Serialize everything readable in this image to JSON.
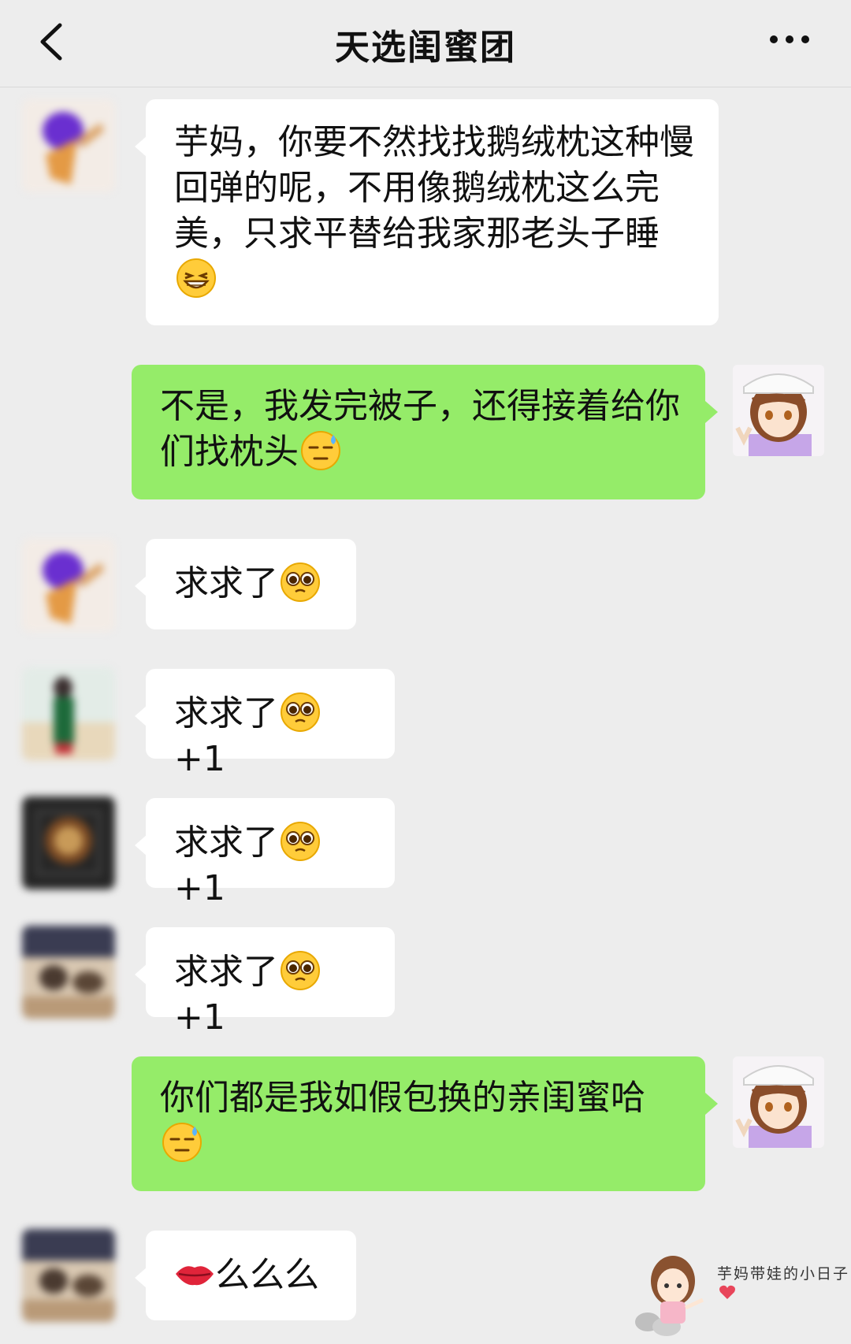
{
  "header": {
    "title": "天选闺蜜团"
  },
  "messages": [
    {
      "side": "in",
      "text": "芋妈，你要不然找找鹅绒枕这种慢回弹的呢，不用像鹅绒枕这么完美，只求平替给我家那老头子睡",
      "emoji": "grinning-squint-emoji"
    },
    {
      "side": "out",
      "text": "不是，我发完被子，还得接着给你们找枕头",
      "emoji": "downcast-sweat-emoji"
    },
    {
      "side": "in",
      "text": "求求了",
      "emoji": "pleading-emoji",
      "suffix": ""
    },
    {
      "side": "in",
      "text": "求求了",
      "emoji": "pleading-emoji",
      "suffix": "+1"
    },
    {
      "side": "in",
      "text": "求求了",
      "emoji": "pleading-emoji",
      "suffix": "+1"
    },
    {
      "side": "in",
      "text": "求求了",
      "emoji": "pleading-emoji",
      "suffix": "+1"
    },
    {
      "side": "out",
      "text": "你们都是我如假包换的亲闺蜜哈",
      "emoji": "downcast-sweat-emoji"
    },
    {
      "side": "in",
      "prefix_emoji": "lips-emoji",
      "text": "么么么"
    }
  ],
  "watermark": {
    "text": "芋妈带娃的小日子"
  },
  "colors": {
    "background": "#ededed",
    "bubble_out": "#95ec69",
    "bubble_in": "#ffffff"
  }
}
